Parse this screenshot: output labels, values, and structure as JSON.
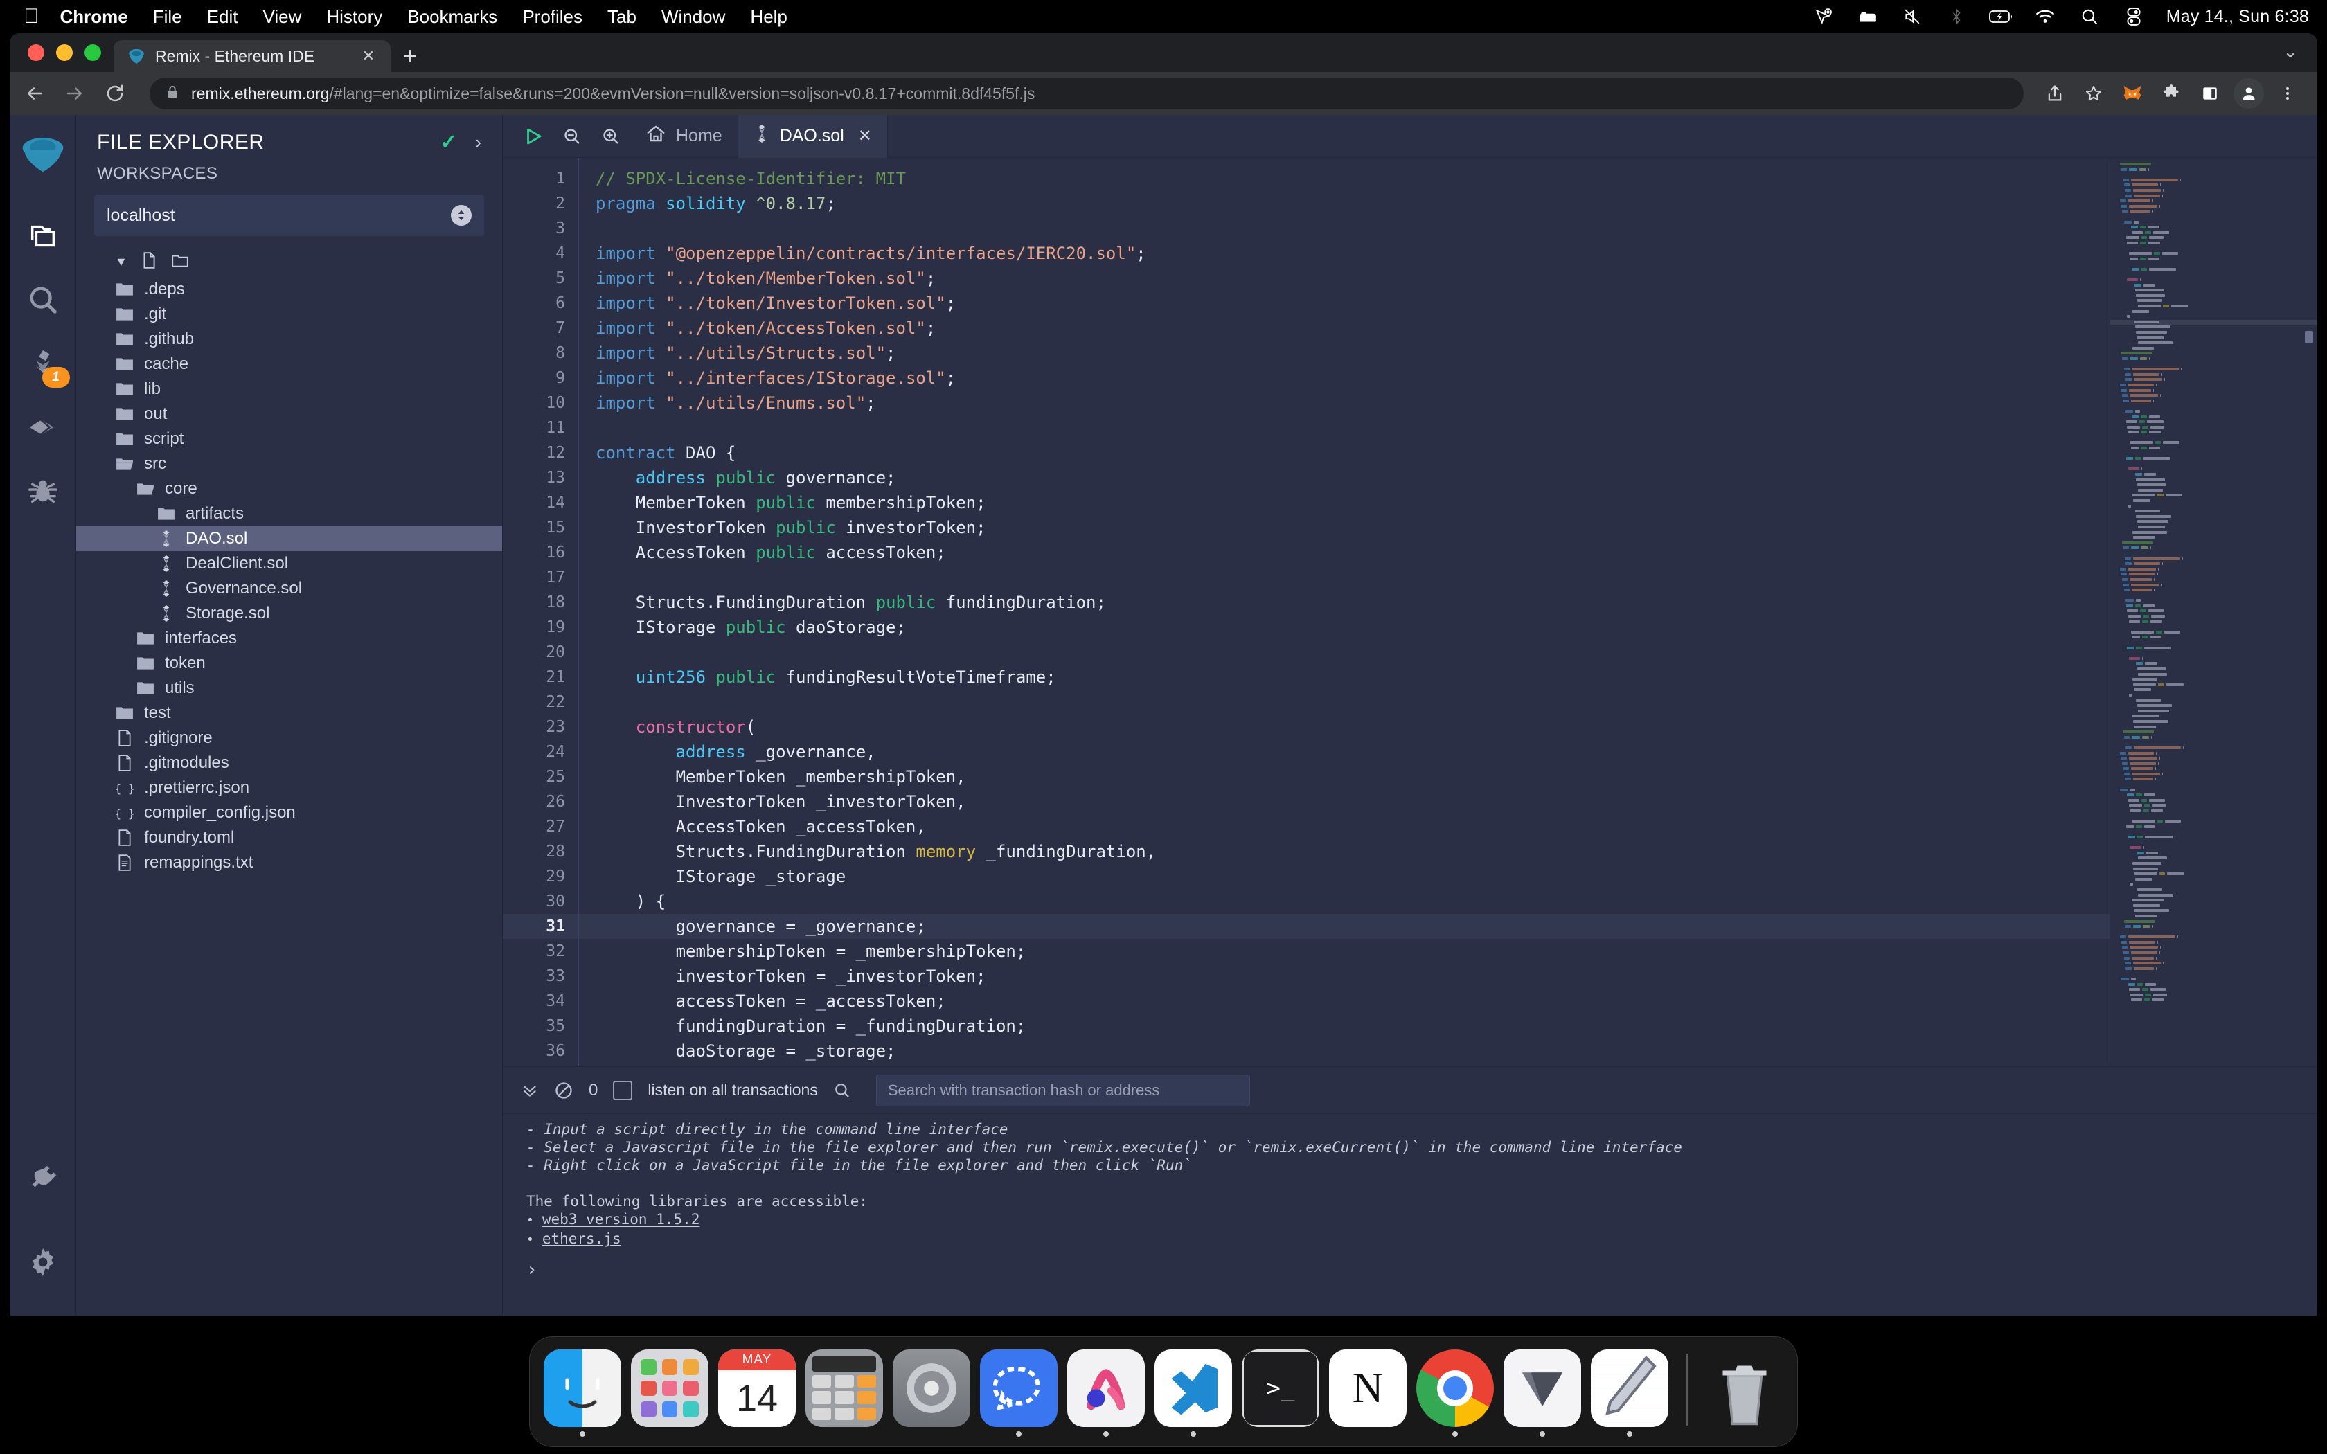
{
  "menubar": {
    "apple": "",
    "items": [
      {
        "label": "Chrome",
        "bold": true
      },
      {
        "label": "File"
      },
      {
        "label": "Edit"
      },
      {
        "label": "View"
      },
      {
        "label": "History"
      },
      {
        "label": "Bookmarks"
      },
      {
        "label": "Profiles"
      },
      {
        "label": "Tab"
      },
      {
        "label": "Window"
      },
      {
        "label": "Help"
      }
    ],
    "status_icons": [
      "location-off-icon",
      "bed-icon",
      "mute-icon",
      "bluetooth-icon",
      "battery-charging-icon",
      "wifi-icon",
      "spotlight-search-icon",
      "control-center-icon"
    ],
    "clock": "May 14., Sun  6:38"
  },
  "browser": {
    "tab": {
      "title": "Remix - Ethereum IDE",
      "favicon": "remix-logo-icon",
      "close": "✕"
    },
    "new_tab": "+",
    "window_chevron": "⌄",
    "toolbar": {
      "back": "←",
      "forward": "→",
      "reload": "↻",
      "lock": "lock-icon",
      "url_domain": "remix.ethereum.org",
      "url_path": "/#lang=en&optimize=false&runs=200&evmVersion=null&version=soljson-v0.8.17+commit.8df45f5f.js",
      "icons": [
        "share-icon",
        "bookmark-star-icon",
        "metamask-icon",
        "extensions-puzzle-icon",
        "side-panel-icon",
        "profile-avatar-icon",
        "chrome-menu-icon"
      ]
    }
  },
  "remix": {
    "rail": [
      {
        "name": "remix-logo",
        "label": "Remix"
      },
      {
        "name": "file-explorer",
        "label": "File explorer"
      },
      {
        "name": "search",
        "label": "Search in files"
      },
      {
        "name": "solidity-compiler",
        "label": "Solidity compiler",
        "badge": "1"
      },
      {
        "name": "deploy-run",
        "label": "Deploy & run transactions"
      },
      {
        "name": "debugger",
        "label": "Debugger"
      }
    ],
    "rail_bottom": [
      {
        "name": "plugin-manager",
        "label": "Plugin manager"
      },
      {
        "name": "settings",
        "label": "Settings"
      }
    ],
    "explorer": {
      "header": "FILE EXPLORER",
      "header_check": "✓",
      "header_chevron": "›",
      "workspaces_label": "WORKSPACES",
      "workspace_value": "localhost",
      "tree_actions": [
        "new-file-icon",
        "new-folder-icon"
      ],
      "tree": [
        {
          "label": ".deps",
          "type": "folder",
          "indent": 0
        },
        {
          "label": ".git",
          "type": "folder",
          "indent": 0
        },
        {
          "label": ".github",
          "type": "folder",
          "indent": 0
        },
        {
          "label": "cache",
          "type": "folder",
          "indent": 0
        },
        {
          "label": "lib",
          "type": "folder",
          "indent": 0
        },
        {
          "label": "out",
          "type": "folder",
          "indent": 0
        },
        {
          "label": "script",
          "type": "folder",
          "indent": 0
        },
        {
          "label": "src",
          "type": "folder-open",
          "indent": 0
        },
        {
          "label": "core",
          "type": "folder-open",
          "indent": 1
        },
        {
          "label": "artifacts",
          "type": "folder",
          "indent": 2
        },
        {
          "label": "DAO.sol",
          "type": "solidity",
          "indent": 2,
          "selected": true
        },
        {
          "label": "DealClient.sol",
          "type": "solidity",
          "indent": 2
        },
        {
          "label": "Governance.sol",
          "type": "solidity",
          "indent": 2
        },
        {
          "label": "Storage.sol",
          "type": "solidity",
          "indent": 2
        },
        {
          "label": "interfaces",
          "type": "folder",
          "indent": 1
        },
        {
          "label": "token",
          "type": "folder",
          "indent": 1
        },
        {
          "label": "utils",
          "type": "folder",
          "indent": 1
        },
        {
          "label": "test",
          "type": "folder",
          "indent": 0
        },
        {
          "label": ".gitignore",
          "type": "file",
          "indent": 0
        },
        {
          "label": ".gitmodules",
          "type": "file",
          "indent": 0
        },
        {
          "label": ".prettierrc.json",
          "type": "json",
          "indent": 0
        },
        {
          "label": "compiler_config.json",
          "type": "json",
          "indent": 0
        },
        {
          "label": "foundry.toml",
          "type": "file",
          "indent": 0
        },
        {
          "label": "remappings.txt",
          "type": "text",
          "indent": 0
        }
      ]
    },
    "editor": {
      "toolbar": {
        "run": "run-script-icon",
        "zoom_out": "zoom-out-icon",
        "zoom_in": "zoom-in-icon",
        "home_label": "Home"
      },
      "tab": {
        "label": "DAO.sol",
        "icon": "solidity-icon",
        "close": "✕"
      },
      "active_line": 31,
      "first_line": 1,
      "lines": [
        {
          "n": 1,
          "tokens": [
            {
              "t": "// SPDX-License-Identifier: MIT",
              "c": "t-com"
            }
          ]
        },
        {
          "n": 2,
          "tokens": [
            {
              "t": "pragma",
              "c": "t-kw"
            },
            {
              "t": " solidity ",
              "c": "t-typ"
            },
            {
              "t": "^0.8.17",
              "c": "t-num"
            },
            {
              "t": ";",
              "c": "t-pln"
            }
          ]
        },
        {
          "n": 3,
          "tokens": []
        },
        {
          "n": 4,
          "tokens": [
            {
              "t": "import",
              "c": "t-kw"
            },
            {
              "t": " ",
              "c": "t-pln"
            },
            {
              "t": "\"@openzeppelin/contracts/interfaces/IERC20.sol\"",
              "c": "t-str"
            },
            {
              "t": ";",
              "c": "t-pln"
            }
          ]
        },
        {
          "n": 5,
          "tokens": [
            {
              "t": "import",
              "c": "t-kw"
            },
            {
              "t": " ",
              "c": "t-pln"
            },
            {
              "t": "\"../token/MemberToken.sol\"",
              "c": "t-str"
            },
            {
              "t": ";",
              "c": "t-pln"
            }
          ]
        },
        {
          "n": 6,
          "tokens": [
            {
              "t": "import",
              "c": "t-kw"
            },
            {
              "t": " ",
              "c": "t-pln"
            },
            {
              "t": "\"../token/InvestorToken.sol\"",
              "c": "t-str"
            },
            {
              "t": ";",
              "c": "t-pln"
            }
          ]
        },
        {
          "n": 7,
          "tokens": [
            {
              "t": "import",
              "c": "t-kw"
            },
            {
              "t": " ",
              "c": "t-pln"
            },
            {
              "t": "\"../token/AccessToken.sol\"",
              "c": "t-str"
            },
            {
              "t": ";",
              "c": "t-pln"
            }
          ]
        },
        {
          "n": 8,
          "tokens": [
            {
              "t": "import",
              "c": "t-kw"
            },
            {
              "t": " ",
              "c": "t-pln"
            },
            {
              "t": "\"../utils/Structs.sol\"",
              "c": "t-str"
            },
            {
              "t": ";",
              "c": "t-pln"
            }
          ]
        },
        {
          "n": 9,
          "tokens": [
            {
              "t": "import",
              "c": "t-kw"
            },
            {
              "t": " ",
              "c": "t-pln"
            },
            {
              "t": "\"../interfaces/IStorage.sol\"",
              "c": "t-str"
            },
            {
              "t": ";",
              "c": "t-pln"
            }
          ]
        },
        {
          "n": 10,
          "tokens": [
            {
              "t": "import",
              "c": "t-kw"
            },
            {
              "t": " ",
              "c": "t-pln"
            },
            {
              "t": "\"../utils/Enums.sol\"",
              "c": "t-str"
            },
            {
              "t": ";",
              "c": "t-pln"
            }
          ]
        },
        {
          "n": 11,
          "tokens": []
        },
        {
          "n": 12,
          "tokens": [
            {
              "t": "contract",
              "c": "t-kw"
            },
            {
              "t": " DAO {",
              "c": "t-pln"
            }
          ]
        },
        {
          "n": 13,
          "tokens": [
            {
              "t": "    ",
              "c": "t-pln"
            },
            {
              "t": "address",
              "c": "t-typ"
            },
            {
              "t": " ",
              "c": "t-pln"
            },
            {
              "t": "public",
              "c": "t-grn"
            },
            {
              "t": " governance;",
              "c": "t-pln"
            }
          ]
        },
        {
          "n": 14,
          "tokens": [
            {
              "t": "    MemberToken ",
              "c": "t-pln"
            },
            {
              "t": "public",
              "c": "t-grn"
            },
            {
              "t": " membershipToken;",
              "c": "t-pln"
            }
          ]
        },
        {
          "n": 15,
          "tokens": [
            {
              "t": "    InvestorToken ",
              "c": "t-pln"
            },
            {
              "t": "public",
              "c": "t-grn"
            },
            {
              "t": " investorToken;",
              "c": "t-pln"
            }
          ]
        },
        {
          "n": 16,
          "tokens": [
            {
              "t": "    AccessToken ",
              "c": "t-pln"
            },
            {
              "t": "public",
              "c": "t-grn"
            },
            {
              "t": " accessToken;",
              "c": "t-pln"
            }
          ]
        },
        {
          "n": 17,
          "tokens": []
        },
        {
          "n": 18,
          "tokens": [
            {
              "t": "    Structs.FundingDuration ",
              "c": "t-pln"
            },
            {
              "t": "public",
              "c": "t-grn"
            },
            {
              "t": " fundingDuration;",
              "c": "t-pln"
            }
          ]
        },
        {
          "n": 19,
          "tokens": [
            {
              "t": "    IStorage ",
              "c": "t-pln"
            },
            {
              "t": "public",
              "c": "t-grn"
            },
            {
              "t": " daoStorage;",
              "c": "t-pln"
            }
          ]
        },
        {
          "n": 20,
          "tokens": []
        },
        {
          "n": 21,
          "tokens": [
            {
              "t": "    ",
              "c": "t-pln"
            },
            {
              "t": "uint256",
              "c": "t-typ"
            },
            {
              "t": " ",
              "c": "t-pln"
            },
            {
              "t": "public",
              "c": "t-grn"
            },
            {
              "t": " fundingResultVoteTimeframe;",
              "c": "t-pln"
            }
          ]
        },
        {
          "n": 22,
          "tokens": []
        },
        {
          "n": 23,
          "tokens": [
            {
              "t": "    ",
              "c": "t-pln"
            },
            {
              "t": "constructor",
              "c": "t-mag"
            },
            {
              "t": "(",
              "c": "t-pln"
            }
          ]
        },
        {
          "n": 24,
          "tokens": [
            {
              "t": "        ",
              "c": "t-pln"
            },
            {
              "t": "address",
              "c": "t-typ"
            },
            {
              "t": " _governance,",
              "c": "t-pln"
            }
          ]
        },
        {
          "n": 25,
          "tokens": [
            {
              "t": "        MemberToken _membershipToken,",
              "c": "t-pln"
            }
          ]
        },
        {
          "n": 26,
          "tokens": [
            {
              "t": "        InvestorToken _investorToken,",
              "c": "t-pln"
            }
          ]
        },
        {
          "n": 27,
          "tokens": [
            {
              "t": "        AccessToken _accessToken,",
              "c": "t-pln"
            }
          ]
        },
        {
          "n": 28,
          "tokens": [
            {
              "t": "        Structs.FundingDuration ",
              "c": "t-pln"
            },
            {
              "t": "memory",
              "c": "t-yel"
            },
            {
              "t": " _fundingDuration,",
              "c": "t-pln"
            }
          ]
        },
        {
          "n": 29,
          "tokens": [
            {
              "t": "        IStorage _storage",
              "c": "t-pln"
            }
          ]
        },
        {
          "n": 30,
          "tokens": [
            {
              "t": "    ) {",
              "c": "t-pln"
            }
          ]
        },
        {
          "n": 31,
          "tokens": [
            {
              "t": "        governance = _governance;",
              "c": "t-pln"
            }
          ]
        },
        {
          "n": 32,
          "tokens": [
            {
              "t": "        membershipToken = _membershipToken;",
              "c": "t-pln"
            }
          ]
        },
        {
          "n": 33,
          "tokens": [
            {
              "t": "        investorToken = _investorToken;",
              "c": "t-pln"
            }
          ]
        },
        {
          "n": 34,
          "tokens": [
            {
              "t": "        accessToken = _accessToken;",
              "c": "t-pln"
            }
          ]
        },
        {
          "n": 35,
          "tokens": [
            {
              "t": "        fundingDuration = _fundingDuration;",
              "c": "t-pln"
            }
          ]
        },
        {
          "n": 36,
          "tokens": [
            {
              "t": "        daoStorage = _storage;",
              "c": "t-pln"
            }
          ]
        }
      ]
    },
    "terminal": {
      "collapse_icon": "chevrons-down-icon",
      "clear_icon": "no-entry-icon",
      "pending_count": "0",
      "listen_label": "listen on all transactions",
      "search_icon": "search-icon",
      "search_placeholder": "Search with transaction hash or address",
      "output": [
        "  - Input a script directly in the command line interface",
        "  - Select a Javascript file in the file explorer and then run `remix.execute()` or `remix.exeCurrent()`  in the command line interface",
        "  - Right click on a JavaScript file in the file explorer and then click `Run`",
        "",
        " The following libraries are accessible:"
      ],
      "links": [
        "web3 version 1.5.2",
        "ethers.js"
      ],
      "prompt": "›"
    }
  },
  "dock": {
    "items": [
      {
        "name": "finder",
        "label": "Finder",
        "running": true
      },
      {
        "name": "launchpad",
        "label": "Launchpad",
        "running": false
      },
      {
        "name": "calendar",
        "label": "Calendar",
        "running": false,
        "month": "MAY",
        "day": "14"
      },
      {
        "name": "calculator",
        "label": "Calculator",
        "running": false
      },
      {
        "name": "system-settings",
        "label": "System Settings",
        "running": false
      },
      {
        "name": "signal",
        "label": "Signal",
        "running": true
      },
      {
        "name": "arc",
        "label": "Arc",
        "running": true
      },
      {
        "name": "vscode",
        "label": "Visual Studio Code",
        "running": true
      },
      {
        "name": "terminal",
        "label": "Terminal",
        "running": false
      },
      {
        "name": "notion",
        "label": "Notion",
        "running": false
      },
      {
        "name": "chrome",
        "label": "Google Chrome",
        "running": true
      },
      {
        "name": "tower",
        "label": "Tower",
        "running": true
      },
      {
        "name": "notes",
        "label": "Notes",
        "running": true
      }
    ],
    "trash": {
      "name": "trash",
      "label": "Trash"
    }
  },
  "colors": {
    "remix_bg": "#2a2f45",
    "panel_bg": "#2a2f45",
    "selection": "#5c6180",
    "accent_green": "#2fcc8b",
    "badge_orange": "#f7931e",
    "chrome_toolbar": "#35363a"
  }
}
